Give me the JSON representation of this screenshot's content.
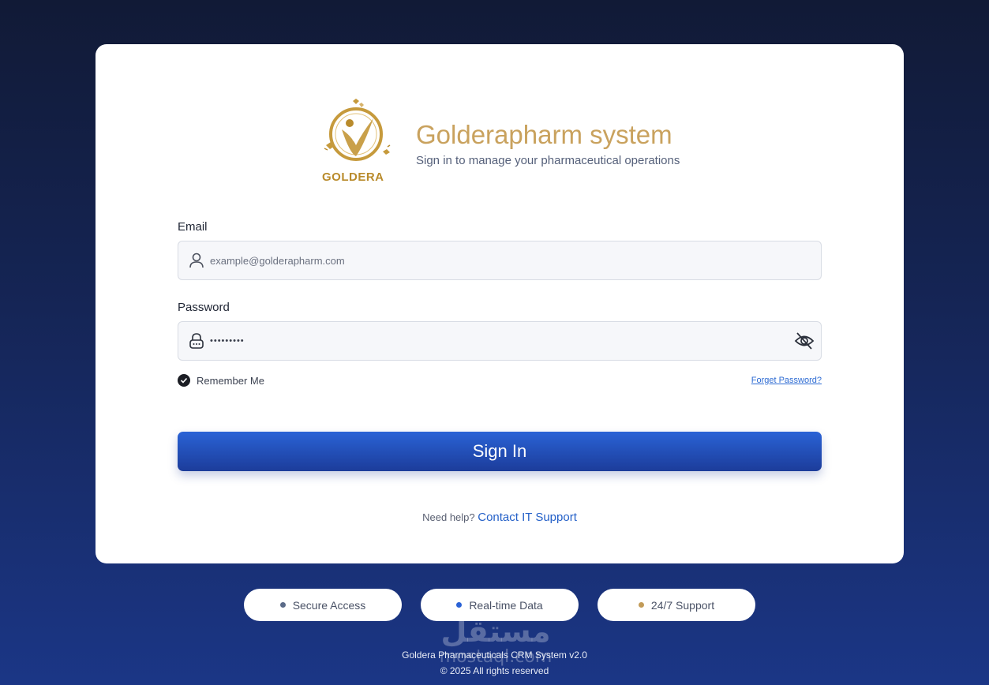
{
  "brand": {
    "logo_text": "GOLDERA",
    "title": "Golderapharm system",
    "subtitle": "Sign in to manage your pharmaceutical operations"
  },
  "form": {
    "email_label": "Email",
    "email_placeholder": "example@golderapharm.com",
    "email_value": "",
    "password_label": "Password",
    "password_value": "•••••••••",
    "remember_label": "Remember Me",
    "remember_checked": true,
    "forgot_label": "Forget Password?",
    "signin_label": "Sign In"
  },
  "help": {
    "prefix": "Need help?",
    "link": "Contact IT Support"
  },
  "badges": [
    {
      "label": "Secure Access",
      "dot_color": "#5a6a88"
    },
    {
      "label": "Real-time Data",
      "dot_color": "#2a62d6"
    },
    {
      "label": "24/7 Support",
      "dot_color": "#c29b58"
    }
  ],
  "footer": {
    "line1": "Goldera Pharmaceuticals CRM System v2.0",
    "line2": "© 2025 All rights reserved"
  },
  "watermark": {
    "arabic": "مستقل",
    "latin": "mostaql.com"
  },
  "icons": {
    "email": "user-icon",
    "password": "lock-icon",
    "visibility": "eye-off-icon",
    "remember": "check-icon"
  },
  "colors": {
    "brand_gold": "#c9a25e",
    "primary_blue": "#2a63d6",
    "link_blue": "#2460c8"
  }
}
